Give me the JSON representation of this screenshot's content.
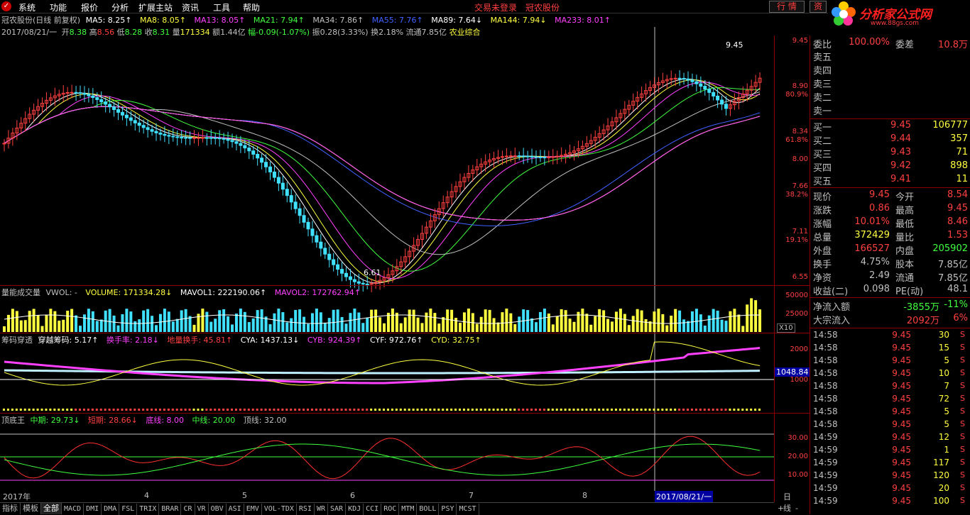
{
  "menu": {
    "items": [
      "系统",
      "功能",
      "报价",
      "分析",
      "扩展主站",
      "资讯",
      "工具",
      "帮助"
    ],
    "status_login": "交易未登录",
    "status_stock": "冠农股份",
    "tab_quote": "行 情",
    "tab_info": "资"
  },
  "brand": {
    "name": "分析家公式网",
    "url": "www.88gs.com"
  },
  "title_row": {
    "stock": "冠农股份(日线 前复权)",
    "ma5": "MA5: 8.25↑",
    "ma8": "MA8: 8.05↑",
    "ma13": "MA13: 8.05↑",
    "ma21": "MA21: 7.94↑",
    "ma34": "MA34: 7.86↑",
    "ma55": "MA55: 7.76↑",
    "ma89": "MA89: 7.64↓",
    "ma144": "MA144: 7.94↓",
    "ma233": "MA233: 8.01↑"
  },
  "info_row": {
    "date": "2017/08/21/一",
    "open_label": "开",
    "open": "8.38",
    "high_label": "高",
    "high": "8.56",
    "low_label": "低",
    "low": "8.28",
    "close_label": "收",
    "close": "8.31",
    "vol_label": "量",
    "vol": "171334",
    "amt": "额1.44亿",
    "chg": "幅-0.09(-1.07%)",
    "amp": "振0.28(3.33%)",
    "turn": "换2.18%",
    "float": "流通7.85亿",
    "industry": "农业综合"
  },
  "price_axis": [
    "9.45",
    "8.90",
    "80.9%",
    "8.34",
    "61.8%",
    "8.00",
    "7.66",
    "38.2%",
    "7.11",
    "19.1%",
    "6.55"
  ],
  "price_annot": {
    "hi": "9.45",
    "lo": "6.61"
  },
  "vol_panel": {
    "title": "量能成交量",
    "vwol": "VWOL: -",
    "volume": "VOLUME: 171334.28↓",
    "mavol1": "MAVOL1: 222190.06↑",
    "mavol2": "MAVOL2: 172762.94↑",
    "axis": [
      "50000",
      "25000"
    ],
    "mult": "X10"
  },
  "chip_panel": {
    "title": "筹码穿透",
    "cross": "穿越筹码: 5.17↑",
    "turn": "换手率: 2.18↓",
    "ground": "地量换手: 45.81↑",
    "cya": "CYA: 1437.13↓",
    "cyb": "CYB: 924.39↑",
    "cyf": "CYF: 972.76↑",
    "cyd": "CYD: 32.75↑",
    "axis": [
      "2000",
      "1000"
    ],
    "marker": "1048.84"
  },
  "top_panel": {
    "title": "顶底王",
    "mid": "中期: 29.73↓",
    "short": "短期: 28.66↓",
    "bottom": "底线: 8.00",
    "midline": "中线: 20.00",
    "top": "顶线: 32.00",
    "axis": [
      "30.00",
      "20.00",
      "10.00"
    ]
  },
  "date_axis": {
    "labels": [
      "2017年",
      "4",
      "5",
      "6",
      "7",
      "8"
    ],
    "cursor": "2017/08/21/一",
    "period": "日线"
  },
  "bottom_tabs": [
    "指标",
    "模板",
    "全部",
    "MACD",
    "DMI",
    "DMA",
    "FSL",
    "TRIX",
    "BRAR",
    "CR",
    "VR",
    "OBV",
    "ASI",
    "EMV",
    "VOL-TDX",
    "RSI",
    "WR",
    "SAR",
    "KDJ",
    "CCI",
    "ROC",
    "MTM",
    "BOLL",
    "PSY",
    "MCST"
  ],
  "bottom_controls": {
    "plus": "+",
    "minus": "-"
  },
  "order_book": {
    "weibi_label": "委比",
    "weibi": "100.00%",
    "weicha_label": "委差",
    "weicha": "10.8万",
    "sells": [
      {
        "label": "卖五",
        "price": "",
        "vol": ""
      },
      {
        "label": "卖四",
        "price": "",
        "vol": ""
      },
      {
        "label": "卖三",
        "price": "",
        "vol": ""
      },
      {
        "label": "卖二",
        "price": "",
        "vol": ""
      },
      {
        "label": "卖一",
        "price": "",
        "vol": ""
      }
    ],
    "buys": [
      {
        "label": "买一",
        "price": "9.45",
        "vol": "106777"
      },
      {
        "label": "买二",
        "price": "9.44",
        "vol": "357"
      },
      {
        "label": "买三",
        "price": "9.43",
        "vol": "71"
      },
      {
        "label": "买四",
        "price": "9.42",
        "vol": "898"
      },
      {
        "label": "买五",
        "price": "9.41",
        "vol": "11"
      }
    ]
  },
  "stats": [
    {
      "l1": "现价",
      "v1": "9.45",
      "l2": "今开",
      "v2": "8.54"
    },
    {
      "l1": "涨跌",
      "v1": "0.86",
      "l2": "最高",
      "v2": "9.45"
    },
    {
      "l1": "涨幅",
      "v1": "10.01%",
      "l2": "最低",
      "v2": "8.46"
    },
    {
      "l1": "总量",
      "v1": "372429",
      "l2": "量比",
      "v2": "1.53"
    },
    {
      "l1": "外盘",
      "v1": "166527",
      "l2": "内盘",
      "v2": "205902"
    },
    {
      "l1": "换手",
      "v1": "4.75%",
      "l2": "股本",
      "v2": "7.85亿"
    },
    {
      "l1": "净资",
      "v1": "2.49",
      "l2": "流通",
      "v2": "7.85亿"
    },
    {
      "l1": "收益(二)",
      "v1": "0.098",
      "l2": "PE(动)",
      "v2": "48.1"
    }
  ],
  "flow": {
    "net_label": "净流入额",
    "net": "-3855万",
    "net_pct": "-11%",
    "big_label": "大宗流入",
    "big": "2092万",
    "big_pct": "6%"
  },
  "ticks": [
    {
      "t": "14:58",
      "p": "9.45",
      "v": "30",
      "d": "S"
    },
    {
      "t": "14:58",
      "p": "9.45",
      "v": "15",
      "d": "S"
    },
    {
      "t": "14:58",
      "p": "9.45",
      "v": "5",
      "d": "S"
    },
    {
      "t": "14:58",
      "p": "9.45",
      "v": "10",
      "d": "S"
    },
    {
      "t": "14:58",
      "p": "9.45",
      "v": "7",
      "d": "S"
    },
    {
      "t": "14:58",
      "p": "9.45",
      "v": "72",
      "d": "S"
    },
    {
      "t": "14:58",
      "p": "9.45",
      "v": "5",
      "d": "S"
    },
    {
      "t": "14:58",
      "p": "9.45",
      "v": "5",
      "d": "S"
    },
    {
      "t": "14:59",
      "p": "9.45",
      "v": "12",
      "d": "S"
    },
    {
      "t": "14:59",
      "p": "9.45",
      "v": "1",
      "d": "S"
    },
    {
      "t": "14:59",
      "p": "9.45",
      "v": "117",
      "d": "S"
    },
    {
      "t": "14:59",
      "p": "9.45",
      "v": "120",
      "d": "S"
    },
    {
      "t": "14:59",
      "p": "9.45",
      "v": "20",
      "d": "S"
    },
    {
      "t": "14:59",
      "p": "9.45",
      "v": "100",
      "d": "S"
    }
  ],
  "colors": {
    "up": "#ff4040",
    "down": "#40e0ff",
    "yellow": "#ffff40",
    "magenta": "#ff40ff",
    "white": "#ffffff",
    "green": "#40ff40",
    "blue": "#4060ff"
  }
}
